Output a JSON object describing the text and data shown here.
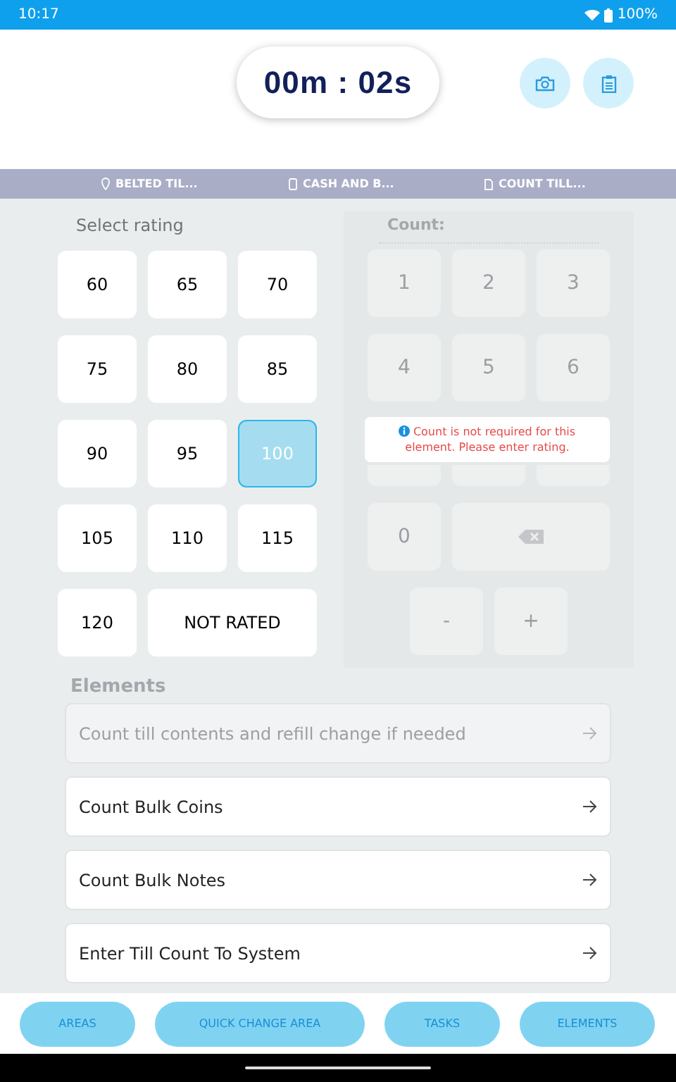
{
  "status_bar": {
    "time": "10:17",
    "battery": "100%"
  },
  "timer": "00m : 02s",
  "breadcrumbs": [
    {
      "kind": "area",
      "label": "BELTED TIL..."
    },
    {
      "kind": "task",
      "label": "CASH AND B..."
    },
    {
      "kind": "element",
      "label": "COUNT TILL..."
    }
  ],
  "rating": {
    "title": "Select rating",
    "options": [
      {
        "label": "60",
        "selected": false
      },
      {
        "label": "65",
        "selected": false
      },
      {
        "label": "70",
        "selected": false
      },
      {
        "label": "75",
        "selected": false
      },
      {
        "label": "80",
        "selected": false
      },
      {
        "label": "85",
        "selected": false
      },
      {
        "label": "90",
        "selected": false
      },
      {
        "label": "95",
        "selected": false
      },
      {
        "label": "100",
        "selected": true
      },
      {
        "label": "105",
        "selected": false
      },
      {
        "label": "110",
        "selected": false
      },
      {
        "label": "115",
        "selected": false
      },
      {
        "label": "120",
        "selected": false
      },
      {
        "label": "NOT RATED",
        "selected": false
      }
    ]
  },
  "keypad": {
    "label": "Count:",
    "disabled": true,
    "rows": [
      [
        {
          "kind": "digit",
          "label": "1"
        },
        {
          "kind": "digit",
          "label": "2"
        },
        {
          "kind": "digit",
          "label": "3"
        }
      ],
      [
        {
          "kind": "digit",
          "label": "4"
        },
        {
          "kind": "digit",
          "label": "5"
        },
        {
          "kind": "digit",
          "label": "6"
        }
      ],
      [
        {
          "kind": "hidden"
        },
        {
          "kind": "hidden"
        },
        {
          "kind": "hidden"
        }
      ],
      [
        {
          "kind": "digit",
          "label": "0"
        },
        {
          "kind": "backspace"
        }
      ],
      [
        {
          "kind": "digit",
          "label": "-"
        },
        {
          "kind": "digit",
          "label": "+"
        }
      ]
    ],
    "message": "Count is not required for this element. Please enter rating."
  },
  "elements": {
    "title": "Elements",
    "items": [
      {
        "label": "Count till contents and refill change if needed",
        "disabled": true
      },
      {
        "label": "Count Bulk Coins",
        "disabled": false
      },
      {
        "label": "Count Bulk Notes",
        "disabled": false
      },
      {
        "label": "Enter Till Count To System",
        "disabled": false
      }
    ]
  },
  "bottom_nav": [
    "AREAS",
    "QUICK CHANGE AREA",
    "TASKS",
    "ELEMENTS"
  ]
}
